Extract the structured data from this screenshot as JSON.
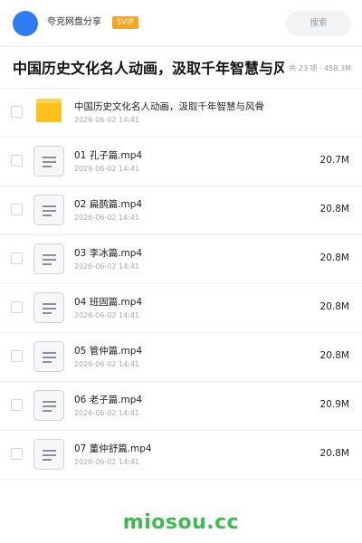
{
  "header": {
    "share_name": "夸克网盘分享",
    "badge": "SVIP",
    "search_placeholder": "搜索"
  },
  "title_row": {
    "title": "中国历史文化名人动画，汲取千年智慧与风骨",
    "meta": "共 23 项 · 458.3M"
  },
  "files": [
    {
      "type": "folder",
      "icon": "folder-icon",
      "name": "中国历史文化名人动画，汲取千年智慧与风骨",
      "date": "2026-06-02 14:41",
      "size": ""
    },
    {
      "type": "file",
      "icon": "file-icon",
      "name": "01 孔子篇.mp4",
      "date": "2026-06-02 14:41",
      "size": "20.7M"
    },
    {
      "type": "file",
      "icon": "file-icon",
      "name": "02 扁鹊篇.mp4",
      "date": "2026-06-02 14:41",
      "size": "20.8M"
    },
    {
      "type": "file",
      "icon": "file-icon",
      "name": "03 李冰篇.mp4",
      "date": "2026-06-02 14:41",
      "size": "20.8M"
    },
    {
      "type": "file",
      "icon": "file-icon",
      "name": "04 班固篇.mp4",
      "date": "2026-06-02 14:41",
      "size": "20.8M"
    },
    {
      "type": "file",
      "icon": "file-icon",
      "name": "05 管仲篇.mp4",
      "date": "2026-06-02 14:41",
      "size": "20.8M"
    },
    {
      "type": "file",
      "icon": "file-icon",
      "name": "06 老子篇.mp4",
      "date": "2026-06-02 14:41",
      "size": "20.9M"
    },
    {
      "type": "file",
      "icon": "file-icon",
      "name": "07 董仲舒篇.mp4",
      "date": "2026-06-02 14:41",
      "size": "20.8M"
    }
  ],
  "watermark": "miosou.cc",
  "colors": {
    "avatar": "#2f7bf2",
    "badge": "#f5a623",
    "folder": "#ffc21a",
    "watermark": "#3dbb50"
  }
}
